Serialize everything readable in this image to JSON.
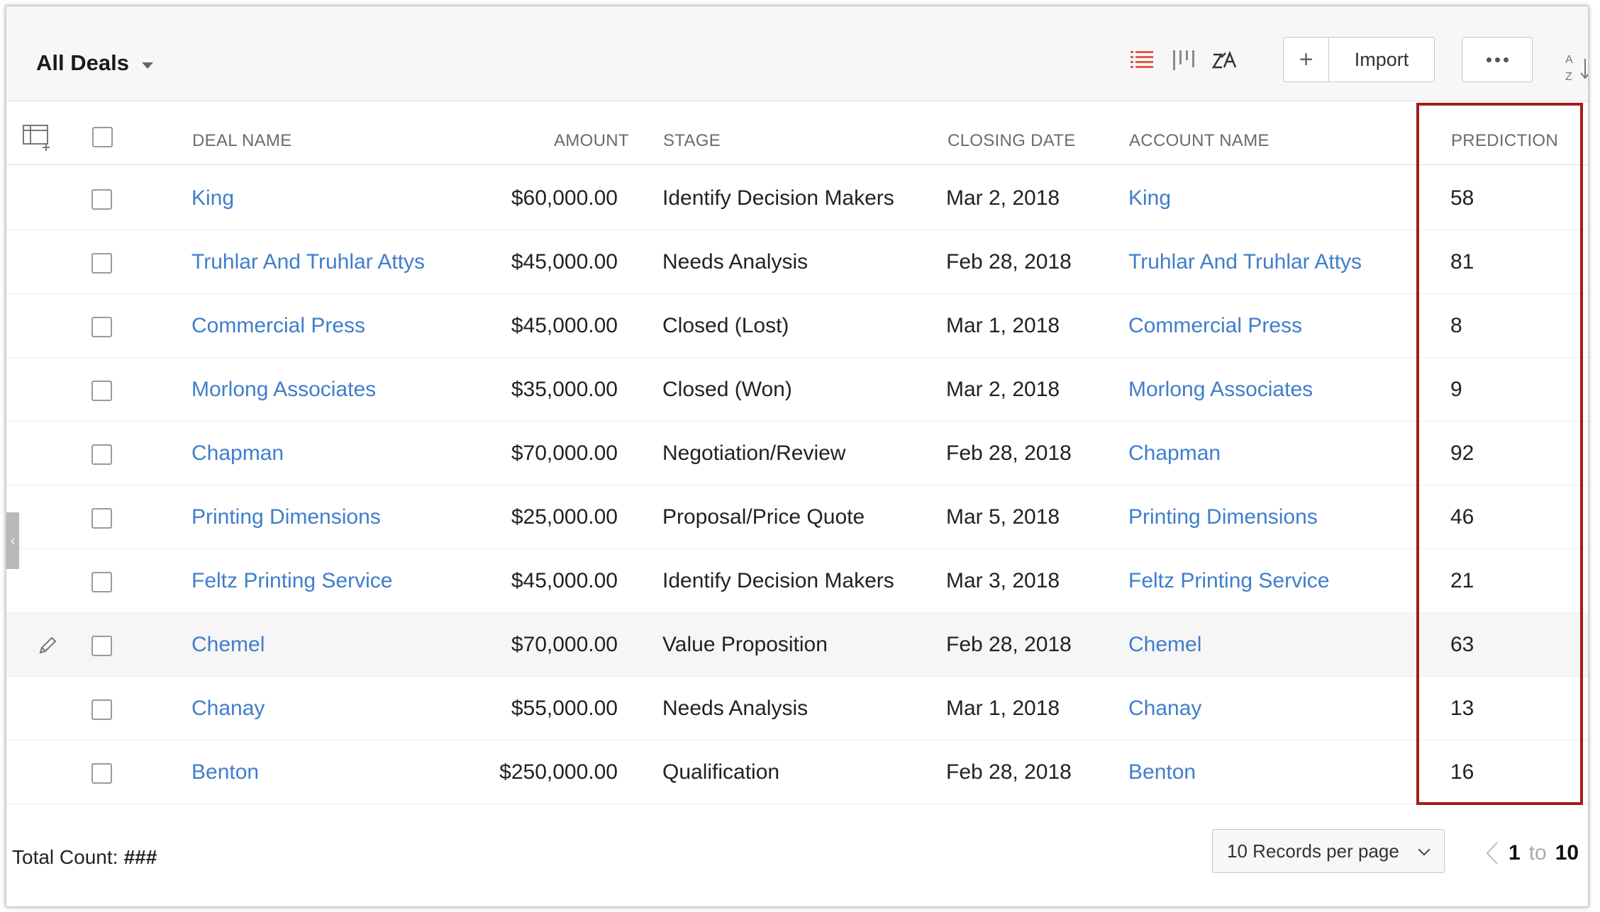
{
  "toolbar": {
    "view_label": "All Deals",
    "import_label": "Import",
    "view_icons": [
      "list-view-icon",
      "kanban-view-icon",
      "zia-icon"
    ],
    "active_color": "#e05a4e"
  },
  "table": {
    "headers": {
      "deal_name": "DEAL NAME",
      "amount": "AMOUNT",
      "stage": "STAGE",
      "closing_date": "CLOSING DATE",
      "account_name": "ACCOUNT NAME",
      "prediction": "PREDICTION"
    },
    "rows": [
      {
        "deal": "King",
        "amount": "$60,000.00",
        "stage": "Identify Decision Makers",
        "date": "Mar 2, 2018",
        "account": "King",
        "prediction": "58"
      },
      {
        "deal": "Truhlar And Truhlar Attys",
        "amount": "$45,000.00",
        "stage": "Needs Analysis",
        "date": "Feb 28, 2018",
        "account": "Truhlar And Truhlar Attys",
        "prediction": "81"
      },
      {
        "deal": "Commercial Press",
        "amount": "$45,000.00",
        "stage": "Closed (Lost)",
        "date": "Mar 1, 2018",
        "account": "Commercial Press",
        "prediction": "8"
      },
      {
        "deal": "Morlong Associates",
        "amount": "$35,000.00",
        "stage": "Closed (Won)",
        "date": "Mar 2, 2018",
        "account": "Morlong Associates",
        "prediction": "9"
      },
      {
        "deal": "Chapman",
        "amount": "$70,000.00",
        "stage": "Negotiation/Review",
        "date": "Feb 28, 2018",
        "account": "Chapman",
        "prediction": "92"
      },
      {
        "deal": "Printing Dimensions",
        "amount": "$25,000.00",
        "stage": "Proposal/Price Quote",
        "date": "Mar 5, 2018",
        "account": "Printing Dimensions",
        "prediction": "46"
      },
      {
        "deal": "Feltz Printing Service",
        "amount": "$45,000.00",
        "stage": "Identify Decision Makers",
        "date": "Mar 3, 2018",
        "account": "Feltz Printing Service",
        "prediction": "21"
      },
      {
        "deal": "Chemel",
        "amount": "$70,000.00",
        "stage": "Value Proposition",
        "date": "Feb 28, 2018",
        "account": "Chemel",
        "prediction": "63"
      },
      {
        "deal": "Chanay",
        "amount": "$55,000.00",
        "stage": "Needs Analysis",
        "date": "Mar 1, 2018",
        "account": "Chanay",
        "prediction": "13"
      },
      {
        "deal": "Benton",
        "amount": "$250,000.00",
        "stage": "Qualification",
        "date": "Feb 28, 2018",
        "account": "Benton",
        "prediction": "16"
      }
    ],
    "highlighted_row": 7
  },
  "footer": {
    "total_label": "Total Count:",
    "total_value": "###",
    "per_page": "10 Records per page",
    "page_from": "1",
    "page_to_word": "to",
    "page_to": "10"
  },
  "colors": {
    "link": "#3f7ecb",
    "highlight_box": "#a61c1c"
  }
}
